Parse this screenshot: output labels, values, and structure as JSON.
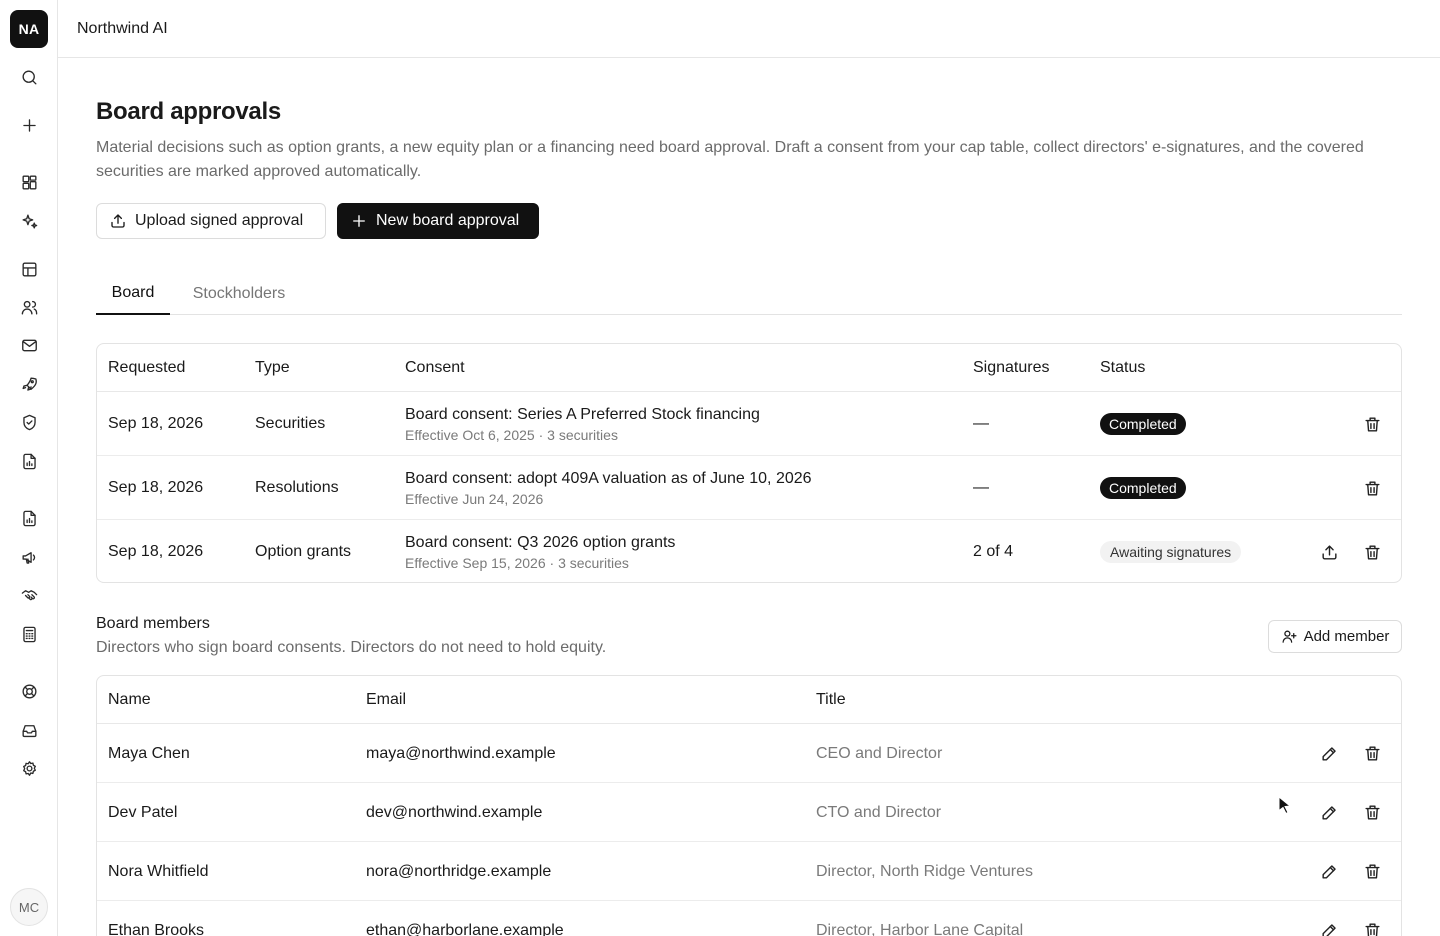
{
  "org": {
    "initials": "NA",
    "name": "Northwind AI"
  },
  "user": {
    "initials": "MC"
  },
  "sidebar": {
    "icons": [
      "search-icon",
      "plus-icon",
      "dashboard-icon",
      "sparkles-icon",
      "table-icon",
      "users-icon",
      "mail-icon",
      "rocket-icon",
      "shield-icon",
      "file-chart-icon",
      "file-chart-icon",
      "megaphone-icon",
      "handshake-icon",
      "calculator-icon",
      "lifebuoy-icon",
      "inbox-icon",
      "gear-icon"
    ]
  },
  "page": {
    "title": "Board approvals",
    "description": "Material decisions such as option grants, a new equity plan or a financing need board approval. Draft a consent from your cap table, collect directors' e-signatures, and the covered securities are marked approved automatically."
  },
  "actions": {
    "upload_label": "Upload signed approval",
    "new_label": "New board approval"
  },
  "tabs": {
    "board": "Board",
    "stockholders": "Stockholders",
    "active": "Board"
  },
  "approvals": {
    "columns": {
      "requested": "Requested",
      "type": "Type",
      "consent": "Consent",
      "signatures": "Signatures",
      "status": "Status"
    },
    "rows": [
      {
        "requested": "Sep 18, 2026",
        "type": "Securities",
        "consent_title": "Board consent: Series A Preferred Stock financing",
        "consent_sub": "Effective Oct 6, 2025 · 3 securities",
        "signatures": "—",
        "status": "Completed"
      },
      {
        "requested": "Sep 18, 2026",
        "type": "Resolutions",
        "consent_title": "Board consent: adopt 409A valuation as of June 10, 2026",
        "consent_sub": "Effective Jun 24, 2026",
        "signatures": "—",
        "status": "Completed"
      },
      {
        "requested": "Sep 18, 2026",
        "type": "Option grants",
        "consent_title": "Board consent: Q3 2026 option grants",
        "consent_sub": "Effective Sep 15, 2026 · 3 securities",
        "signatures": "2 of 4",
        "status": "Awaiting signatures"
      }
    ]
  },
  "members": {
    "title": "Board members",
    "description": "Directors who sign board consents. Directors do not need to hold equity.",
    "add_label": "Add member",
    "columns": {
      "name": "Name",
      "email": "Email",
      "title": "Title"
    },
    "rows": [
      {
        "name": "Maya Chen",
        "email": "maya@northwind.example",
        "title": "CEO and Director"
      },
      {
        "name": "Dev Patel",
        "email": "dev@northwind.example",
        "title": "CTO and Director"
      },
      {
        "name": "Nora Whitfield",
        "email": "nora@northridge.example",
        "title": "Director, North Ridge Ventures"
      },
      {
        "name": "Ethan Brooks",
        "email": "ethan@harborlane.example",
        "title": "Director, Harbor Lane Capital"
      }
    ]
  }
}
